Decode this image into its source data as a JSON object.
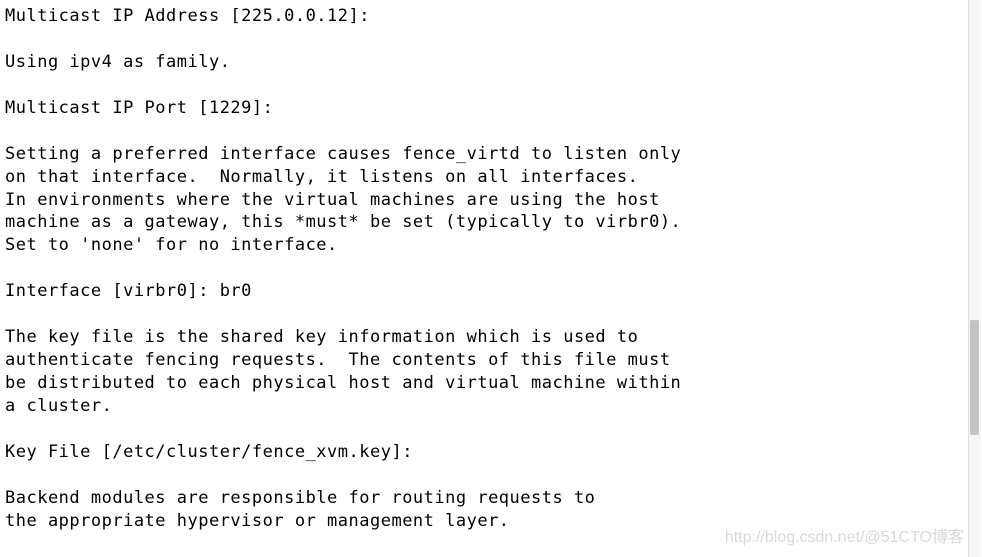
{
  "terminal": {
    "lines": [
      "Multicast IP Address [225.0.0.12]:",
      "",
      "Using ipv4 as family.",
      "",
      "Multicast IP Port [1229]:",
      "",
      "Setting a preferred interface causes fence_virtd to listen only",
      "on that interface.  Normally, it listens on all interfaces.",
      "In environments where the virtual machines are using the host",
      "machine as a gateway, this *must* be set (typically to virbr0).",
      "Set to 'none' for no interface.",
      "",
      "Interface [virbr0]: br0",
      "",
      "The key file is the shared key information which is used to",
      "authenticate fencing requests.  The contents of this file must",
      "be distributed to each physical host and virtual machine within",
      "a cluster.",
      "",
      "Key File [/etc/cluster/fence_xvm.key]:",
      "",
      "Backend modules are responsible for routing requests to",
      "the appropriate hypervisor or management layer."
    ],
    "prompts": {
      "multicast_ip_address": {
        "label": "Multicast IP Address",
        "default": "225.0.0.12",
        "value": ""
      },
      "multicast_ip_port": {
        "label": "Multicast IP Port",
        "default": "1229",
        "value": ""
      },
      "interface": {
        "label": "Interface",
        "default": "virbr0",
        "value": "br0"
      },
      "key_file": {
        "label": "Key File",
        "default": "/etc/cluster/fence_xvm.key",
        "value": ""
      }
    },
    "family_message": "Using ipv4 as family."
  },
  "watermark": "http://blog.csdn.net/@51CTO博客"
}
